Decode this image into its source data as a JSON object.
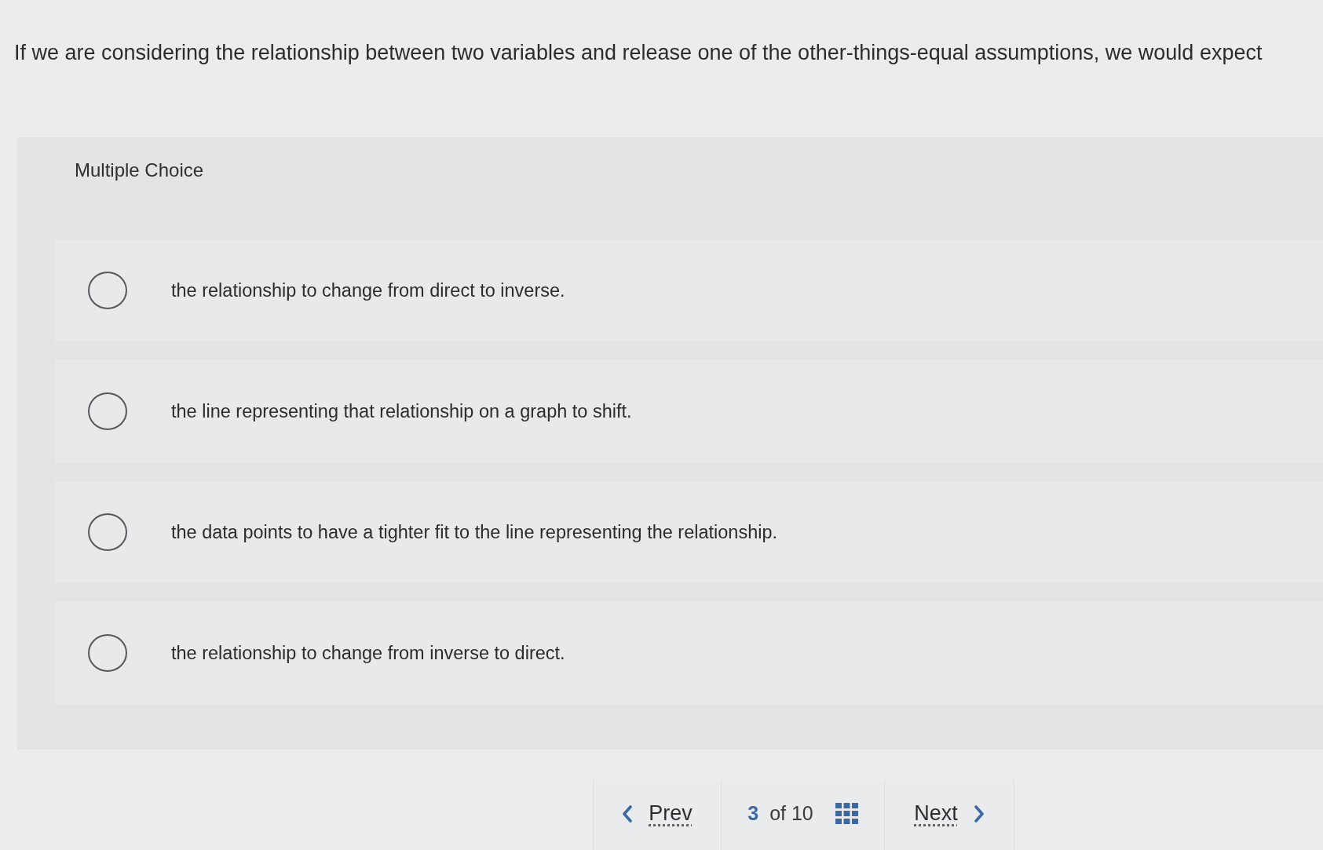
{
  "question": "If we are considering the relationship between two variables and release one of the other-things-equal assumptions, we would expect",
  "section_label": "Multiple Choice",
  "options": [
    {
      "text": "the relationship to change from direct to inverse.",
      "selected": false
    },
    {
      "text": "the line representing that relationship on a graph to shift.",
      "selected": false
    },
    {
      "text": "the data points to have a tighter fit to the line representing the relationship.",
      "selected": false
    },
    {
      "text": "the relationship to change from inverse to direct.",
      "selected": false
    }
  ],
  "navigation": {
    "prev": "Prev",
    "current": "3",
    "total": "of 10",
    "next": "Next"
  }
}
